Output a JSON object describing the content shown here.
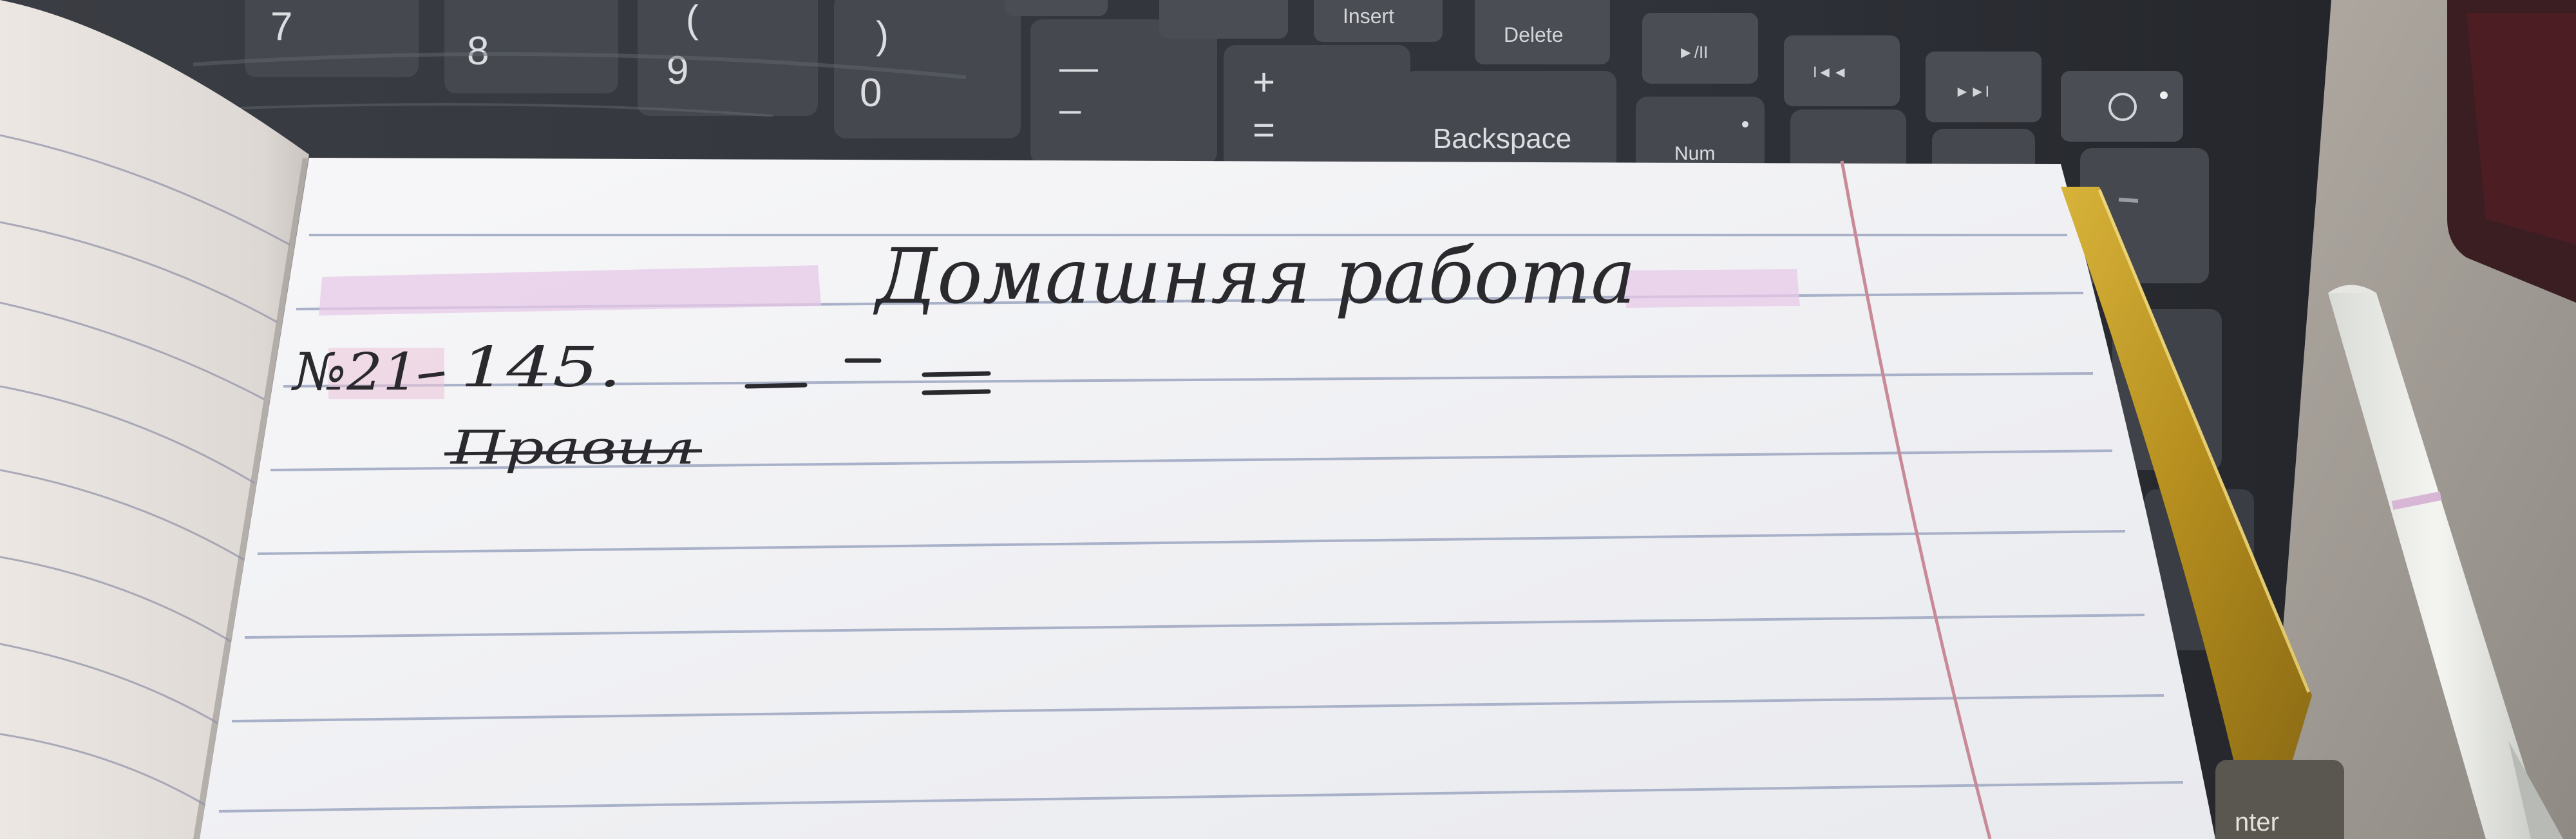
{
  "keyboard": {
    "keys": [
      {
        "main": "7",
        "shift": ""
      },
      {
        "main": "8",
        "shift": ""
      },
      {
        "main": "9",
        "shift": "("
      },
      {
        "main": "0",
        "shift": ")"
      },
      {
        "main": "–",
        "shift": "—"
      },
      {
        "main": "=",
        "shift": "+"
      },
      {
        "main": "Backspace",
        "shift": ""
      },
      {
        "main": "Num",
        "shift": ""
      }
    ],
    "fn_keys": [
      "Insert",
      "Delete",
      "►/II",
      "I◄◄",
      "►►I"
    ],
    "enter_label": "nter"
  },
  "notebook": {
    "heading": "Домашняя работа",
    "entry_number": "№21",
    "exercise": "145.",
    "crossed_word": "Правил"
  },
  "colors": {
    "paper": "#f4f4f6",
    "rule_line": "#a9b1c8",
    "margin_line": "#c98a98",
    "highlight": "#e7c9e8",
    "ink": "#2a2a2e",
    "ruler": "#c9a227"
  }
}
